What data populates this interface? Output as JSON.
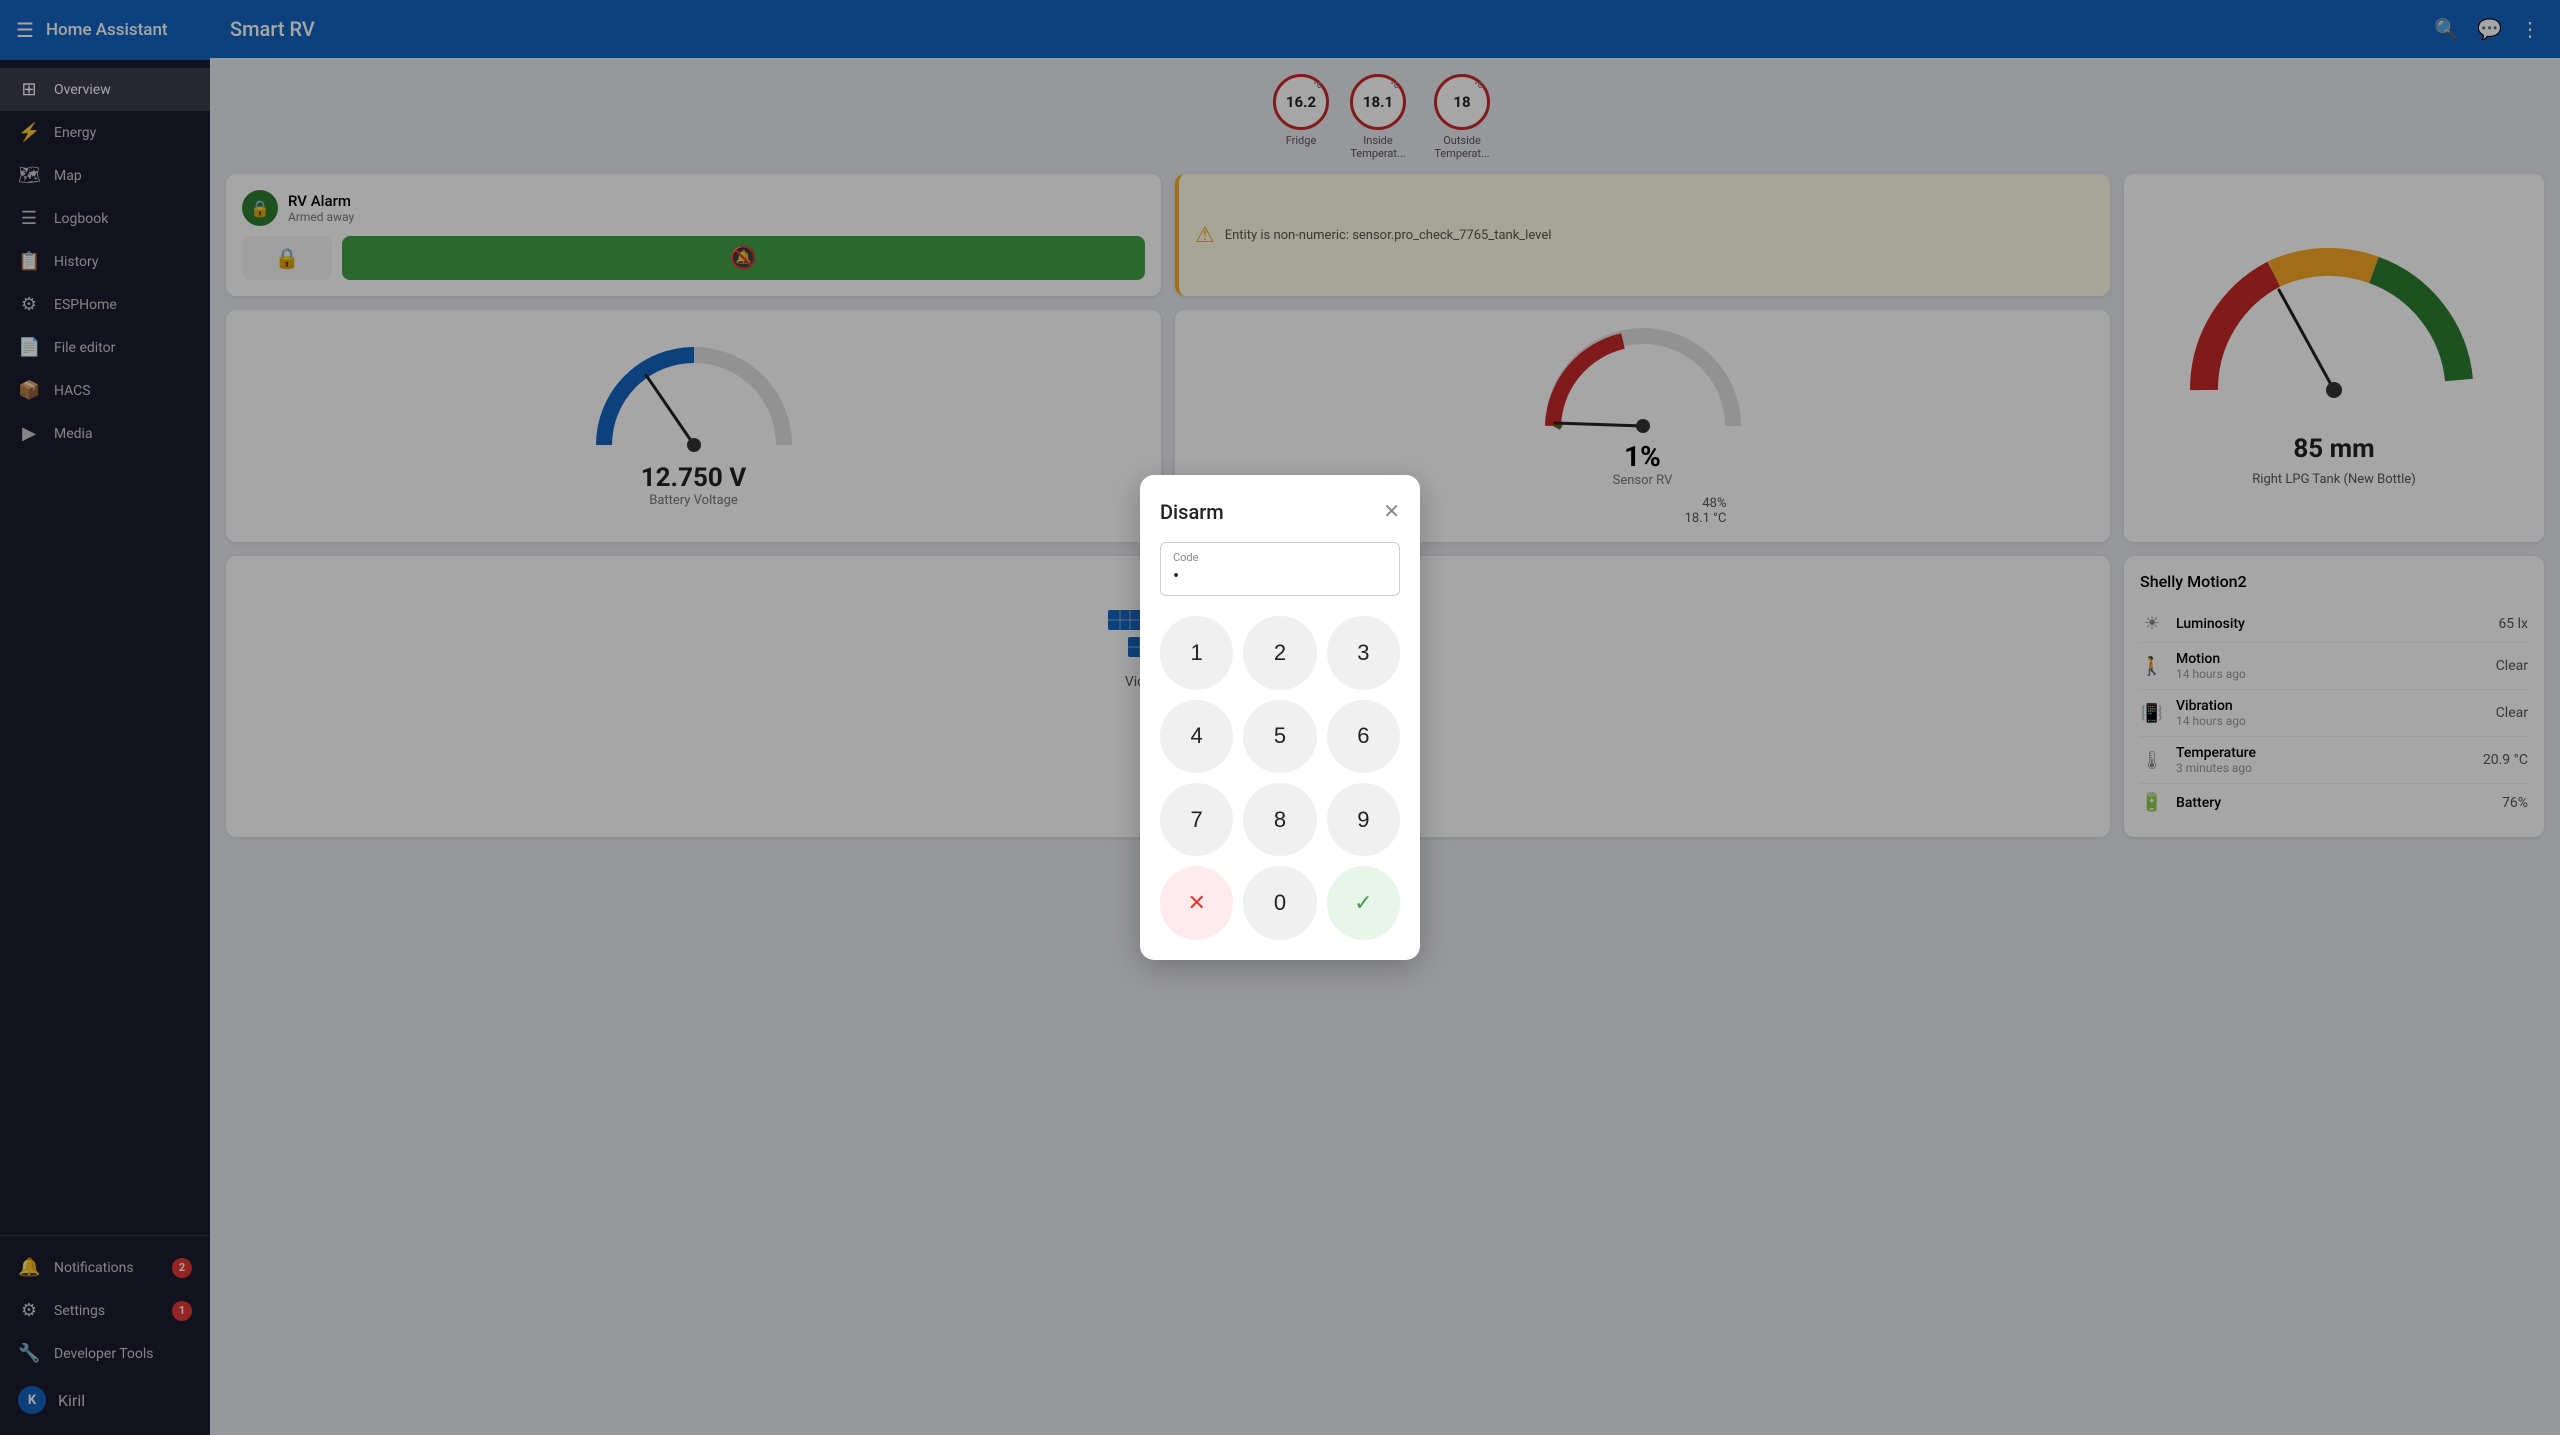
{
  "app": {
    "title": "Home Assistant",
    "page_title": "Smart RV"
  },
  "sidebar": {
    "items": [
      {
        "id": "overview",
        "label": "Overview",
        "icon": "⊞",
        "active": true
      },
      {
        "id": "energy",
        "label": "Energy",
        "icon": "⚡"
      },
      {
        "id": "map",
        "label": "Map",
        "icon": "🗺"
      },
      {
        "id": "logbook",
        "label": "Logbook",
        "icon": "☰"
      },
      {
        "id": "history",
        "label": "History",
        "icon": "📋"
      },
      {
        "id": "esphome",
        "label": "ESPHome",
        "icon": "⚙"
      },
      {
        "id": "file-editor",
        "label": "File editor",
        "icon": "📄"
      },
      {
        "id": "hacs",
        "label": "HACS",
        "icon": "📦"
      },
      {
        "id": "media",
        "label": "Media",
        "icon": "▶"
      }
    ],
    "bottom_items": [
      {
        "id": "developer-tools",
        "label": "Developer Tools",
        "icon": "🔧"
      },
      {
        "id": "settings",
        "label": "Settings",
        "icon": "⚙",
        "badge": "1"
      },
      {
        "id": "notifications",
        "label": "Notifications",
        "icon": "🔔",
        "badge": "2"
      }
    ],
    "user": {
      "label": "Kiril",
      "initial": "K"
    }
  },
  "sensors": [
    {
      "value": "16.2",
      "unit": "°C",
      "label": "Fridge"
    },
    {
      "value": "18.1",
      "unit": "°C",
      "label": "Inside Temperat..."
    },
    {
      "value": "18",
      "unit": "°C",
      "label": "Outside Temperat..."
    }
  ],
  "alarm": {
    "title": "RV Alarm",
    "status": "Armed away"
  },
  "warning": {
    "text": "Entity is non-numeric: sensor.pro_check_7765_tank_level"
  },
  "battery": {
    "voltage": "12.750 V",
    "label": "Battery Voltage"
  },
  "sensor_rv": {
    "percent": "1%",
    "label": "Sensor RV",
    "value_48": "48%",
    "temp": "18.1 °C"
  },
  "lpg": {
    "value": "85 mm",
    "label": "Right LPG Tank (New Bottle)"
  },
  "victron": {
    "label": "Victron MPPT"
  },
  "shelly": {
    "title": "Shelly Motion2",
    "rows": [
      {
        "icon": "☀",
        "name": "Luminosity",
        "time": "",
        "value": "65 lx"
      },
      {
        "icon": "🚶",
        "name": "Motion",
        "time": "14 hours ago",
        "value": "Clear"
      },
      {
        "icon": "📳",
        "name": "Vibration",
        "time": "14 hours ago",
        "value": "Clear"
      },
      {
        "icon": "🌡",
        "name": "Temperature",
        "time": "3 minutes ago",
        "value": "20.9 °C"
      },
      {
        "icon": "🔋",
        "name": "Battery",
        "time": "",
        "value": "76%"
      }
    ]
  },
  "dialog": {
    "title": "Disarm",
    "code_label": "Code",
    "code_value": "•",
    "buttons": [
      "1",
      "2",
      "3",
      "4",
      "5",
      "6",
      "7",
      "8",
      "9",
      "✕",
      "0",
      "✓"
    ]
  }
}
